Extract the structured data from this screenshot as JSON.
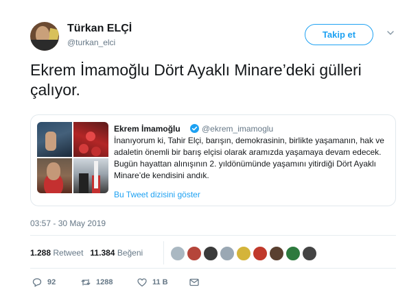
{
  "author": {
    "display_name": "Türkan ELÇİ",
    "handle": "@turkan_elci"
  },
  "follow_label": "Takip et",
  "tweet_text": "Ekrem İmamoğlu Dört Ayaklı Minare’deki gülleri çalıyor.",
  "quoted_tweet": {
    "display_name": "Ekrem İmamoğlu",
    "handle": "@ekrem_imamoglu",
    "text": "İnanıyorum ki, Tahir Elçi, barışın, demokrasinin, birlikte yaşamanın, hak ve adaletin önemli bir barış elçisi olarak aramızda yaşamaya devam edecek. Bugün hayattan alınışının 2. yıldönümünde yaşamını yitirdiği Dört Ayaklı Minare’de kendisini andık.",
    "thread_link": "Bu Tweet dizisini göster"
  },
  "timestamp": "03:57 - 30 May 2019",
  "stats": {
    "retweet_count": "1.288",
    "retweet_label": "Retweet",
    "like_count": "11.384",
    "like_label": "Beğeni"
  },
  "actions": {
    "reply_count": "92",
    "retweet_count": "1288",
    "like_count": "11 B"
  },
  "colors": {
    "accent": "#1da1f2",
    "muted": "#657786",
    "text": "#14171a",
    "border": "#e1e8ed"
  },
  "icons": [
    "chevron-down-icon",
    "verified-badge-icon",
    "reply-icon",
    "retweet-icon",
    "like-icon",
    "message-icon"
  ]
}
